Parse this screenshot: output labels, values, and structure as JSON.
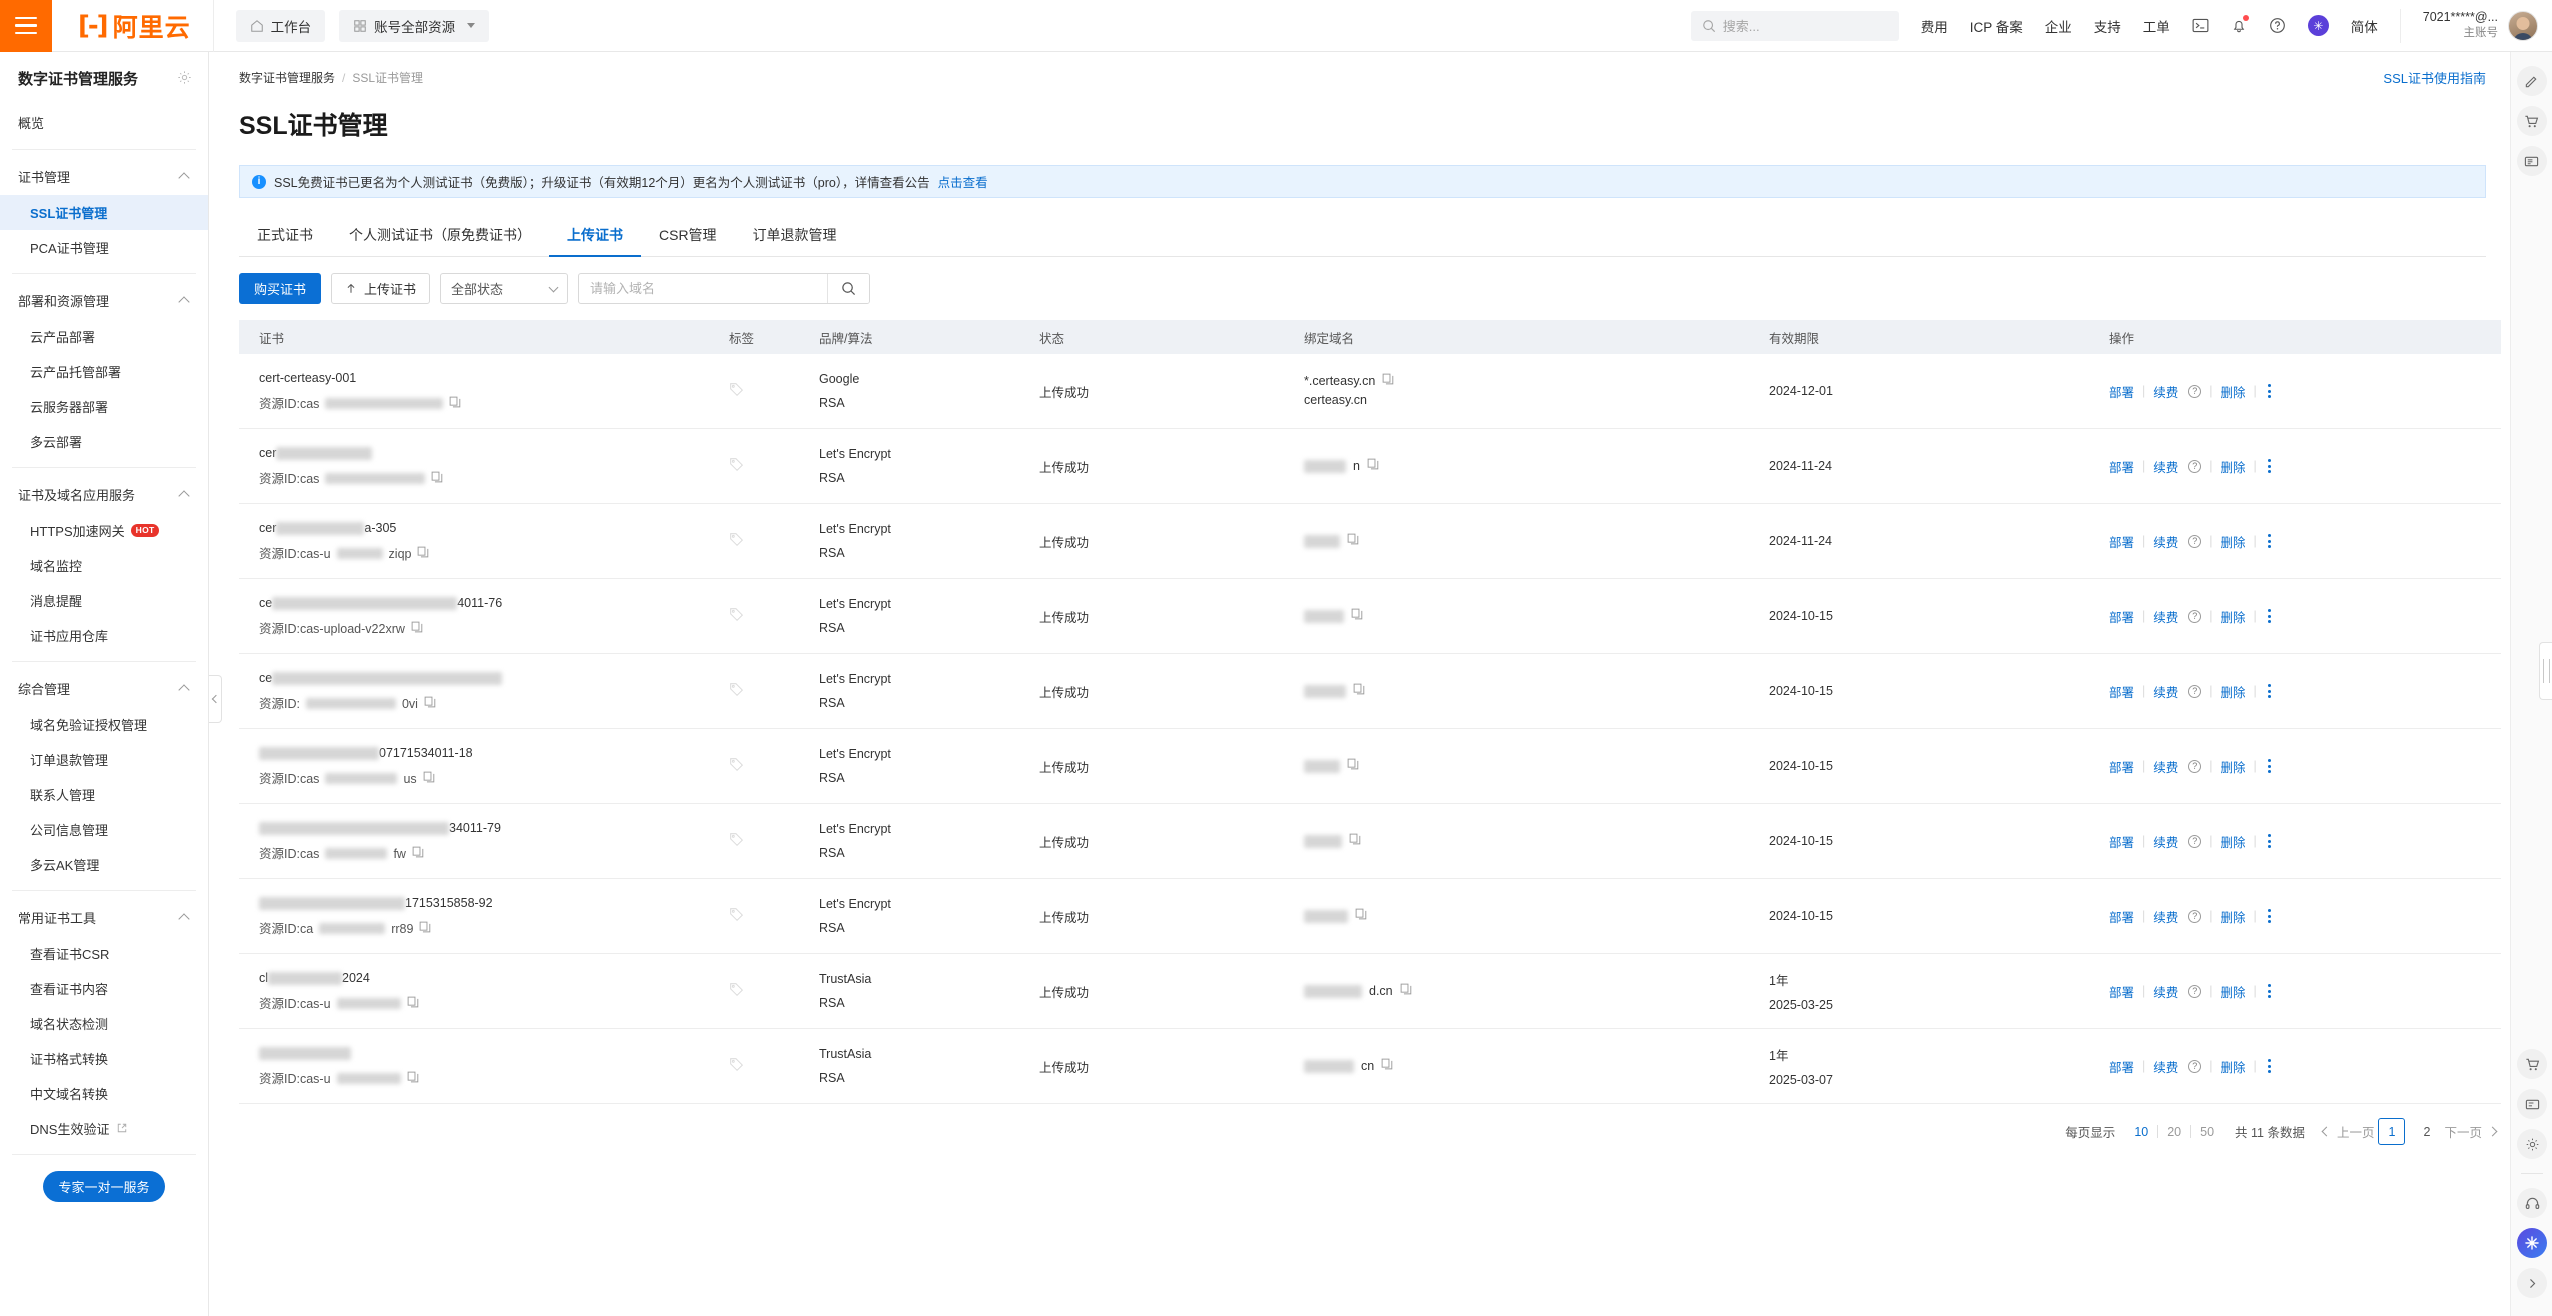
{
  "header": {
    "logo_text": "阿里云",
    "workbench": "工作台",
    "resources": "账号全部资源",
    "search_placeholder": "搜索...",
    "links": [
      "费用",
      "ICP 备案",
      "企业",
      "支持",
      "工单"
    ],
    "icons": [
      "terminal-icon",
      "bell-icon",
      "help-circle-icon",
      "globe-icon"
    ],
    "lang": "简体",
    "user_id": "7021*****@...",
    "user_role": "主账号"
  },
  "sidebar": {
    "title": "数字证书管理服务",
    "overview": "概览",
    "groups": [
      {
        "label": "证书管理",
        "items": [
          {
            "label": "SSL证书管理",
            "active": true
          },
          {
            "label": "PCA证书管理",
            "active": false
          }
        ]
      },
      {
        "label": "部署和资源管理",
        "items": [
          {
            "label": "云产品部署",
            "active": false
          },
          {
            "label": "云产品托管部署",
            "active": false
          },
          {
            "label": "云服务器部署",
            "active": false
          },
          {
            "label": "多云部署",
            "active": false
          }
        ]
      },
      {
        "label": "证书及域名应用服务",
        "items": [
          {
            "label": "HTTPS加速网关",
            "badge": "HOT",
            "active": false
          },
          {
            "label": "域名监控",
            "active": false
          },
          {
            "label": "消息提醒",
            "active": false
          },
          {
            "label": "证书应用仓库",
            "active": false
          }
        ]
      },
      {
        "label": "综合管理",
        "items": [
          {
            "label": "域名免验证授权管理",
            "active": false
          },
          {
            "label": "订单退款管理",
            "active": false
          },
          {
            "label": "联系人管理",
            "active": false
          },
          {
            "label": "公司信息管理",
            "active": false
          },
          {
            "label": "多云AK管理",
            "active": false
          }
        ]
      },
      {
        "label": "常用证书工具",
        "items": [
          {
            "label": "查看证书CSR",
            "active": false
          },
          {
            "label": "查看证书内容",
            "active": false
          },
          {
            "label": "域名状态检测",
            "active": false
          },
          {
            "label": "证书格式转换",
            "active": false
          },
          {
            "label": "中文域名转换",
            "active": false
          },
          {
            "label": "DNS生效验证",
            "external": true,
            "active": false
          }
        ]
      }
    ],
    "expert_button": "专家一对一服务"
  },
  "breadcrumb": {
    "root": "数字证书管理服务",
    "sep": "/",
    "current": "SSL证书管理"
  },
  "page": {
    "title": "SSL证书管理",
    "guide_link": "SSL证书使用指南"
  },
  "notice": {
    "text": "SSL免费证书已更名为个人测试证书（免费版）；升级证书（有效期12个月）更名为个人测试证书（pro），详情查看公告",
    "link": "点击查看"
  },
  "tabs": [
    {
      "label": "正式证书",
      "active": false
    },
    {
      "label": "个人测试证书（原免费证书）",
      "active": false
    },
    {
      "label": "上传证书",
      "active": true
    },
    {
      "label": "CSR管理",
      "active": false
    },
    {
      "label": "订单退款管理",
      "active": false
    }
  ],
  "toolbar": {
    "buy_label": "购买证书",
    "upload_label": "上传证书",
    "status_filter": "全部状态",
    "search_placeholder": "请输入域名"
  },
  "table": {
    "columns": [
      "证书",
      "标签",
      "品牌/算法",
      "状态",
      "绑定域名",
      "有效期限",
      "操作"
    ],
    "ops": {
      "deploy": "部署",
      "renew": "续费",
      "delete": "删除"
    },
    "resource_prefix": "资源ID:",
    "rows": [
      {
        "cert_name": "cert-certeasy-001",
        "cert_name_blur": 0,
        "resource_id": "cas",
        "resource_blur": 118,
        "brand": "Google",
        "algorithm": "RSA",
        "status": "上传成功",
        "domains": [
          "*.certeasy.cn",
          "certeasy.cn"
        ],
        "domain_blur": 0,
        "validity_line1": "2024-12-01",
        "validity_line2": ""
      },
      {
        "cert_name": "cer",
        "cert_name_blur": 96,
        "resource_id": "cas",
        "resource_blur": 100,
        "brand": "Let's Encrypt",
        "algorithm": "RSA",
        "status": "上传成功",
        "domains": [
          "n"
        ],
        "domain_blur": 42,
        "validity_line1": "2024-11-24",
        "validity_line2": ""
      },
      {
        "cert_name": "cer",
        "cert_name_blur": 88,
        "cert_name_suffix": "a-305",
        "resource_id": "cas-u",
        "resource_blur": 46,
        "resource_suffix": "ziqp",
        "brand": "Let's Encrypt",
        "algorithm": "RSA",
        "status": "上传成功",
        "domains": [
          ""
        ],
        "domain_blur": 36,
        "validity_line1": "2024-11-24",
        "validity_line2": ""
      },
      {
        "cert_name": "ce",
        "cert_name_blur": 185,
        "cert_name_suffix": "4011-76",
        "resource_id": "cas-upload-v22xrw",
        "resource_blur": 0,
        "brand": "Let's Encrypt",
        "algorithm": "RSA",
        "status": "上传成功",
        "domains": [
          ""
        ],
        "domain_blur": 40,
        "validity_line1": "2024-10-15",
        "validity_line2": ""
      },
      {
        "cert_name": "ce",
        "cert_name_blur": 230,
        "resource_id": "",
        "resource_blur": 90,
        "resource_suffix": "0vi",
        "brand": "Let's Encrypt",
        "algorithm": "RSA",
        "status": "上传成功",
        "domains": [
          ""
        ],
        "domain_blur": 42,
        "validity_line1": "2024-10-15",
        "validity_line2": ""
      },
      {
        "cert_name": "",
        "cert_name_blur": 120,
        "cert_name_suffix": "07171534011-18",
        "resource_id": "cas",
        "resource_blur": 72,
        "resource_suffix": "us",
        "brand": "Let's Encrypt",
        "algorithm": "RSA",
        "status": "上传成功",
        "domains": [
          ""
        ],
        "domain_blur": 36,
        "validity_line1": "2024-10-15",
        "validity_line2": ""
      },
      {
        "cert_name": "",
        "cert_name_blur": 190,
        "cert_name_suffix": "34011-79",
        "resource_id": "cas",
        "resource_blur": 62,
        "resource_suffix": "fw",
        "brand": "Let's Encrypt",
        "algorithm": "RSA",
        "status": "上传成功",
        "domains": [
          ""
        ],
        "domain_blur": 38,
        "validity_line1": "2024-10-15",
        "validity_line2": ""
      },
      {
        "cert_name": "",
        "cert_name_blur": 146,
        "cert_name_suffix": "1715315858-92",
        "resource_id": "ca",
        "resource_blur": 66,
        "resource_suffix": "rr89",
        "brand": "Let's Encrypt",
        "algorithm": "RSA",
        "status": "上传成功",
        "domains": [
          ""
        ],
        "domain_blur": 44,
        "validity_line1": "2024-10-15",
        "validity_line2": ""
      },
      {
        "cert_name": "cl",
        "cert_name_blur": 74,
        "cert_name_suffix": "2024",
        "resource_id": "cas-u",
        "resource_blur": 64,
        "brand": "TrustAsia",
        "algorithm": "RSA",
        "status": "上传成功",
        "domains": [
          "d.cn"
        ],
        "domain_blur": 58,
        "validity_line1": "1年",
        "validity_line2": "2025-03-25"
      },
      {
        "cert_name": "",
        "cert_name_blur": 92,
        "resource_id": "cas-u",
        "resource_blur": 64,
        "brand": "TrustAsia",
        "algorithm": "RSA",
        "status": "上传成功",
        "domains": [
          "cn"
        ],
        "domain_blur": 50,
        "validity_line1": "1年",
        "validity_line2": "2025-03-07"
      }
    ]
  },
  "pagination": {
    "per_page_label": "每页显示",
    "sizes": [
      "10",
      "20",
      "50"
    ],
    "active_size": "10",
    "total_text": "共 11 条数据",
    "prev": "上一页",
    "next": "下一页",
    "pages": [
      "1",
      "2"
    ],
    "current_page": "1"
  },
  "right_rail": {
    "top_icons": [
      "pencil-icon",
      "cart-icon",
      "ticket-icon"
    ],
    "bottom_icons": [
      "cart-icon",
      "ticket-icon",
      "gear-icon",
      "headset-icon",
      "assistant-icon",
      "chevron-right-icon"
    ]
  },
  "colors": {
    "brand_orange": "#ff6a00",
    "link_blue": "#0a6ecd",
    "primary_blue": "#0b6fd4",
    "notice_bg": "#e8f3fe",
    "hot_red": "#e8342b"
  }
}
